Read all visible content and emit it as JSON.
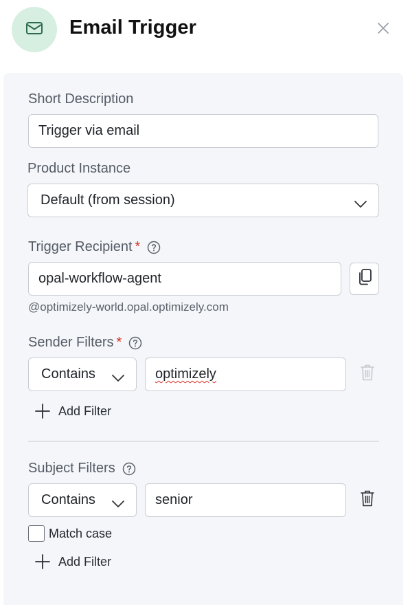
{
  "header": {
    "title": "Email Trigger",
    "icon": "envelope-icon",
    "avatar_color": "#d6efe1",
    "close_icon": "close-icon"
  },
  "short_description": {
    "label": "Short Description",
    "value": "Trigger via email"
  },
  "product_instance": {
    "label": "Product Instance",
    "selected": "Default (from session)"
  },
  "trigger_recipient": {
    "label": "Trigger Recipient",
    "required_mark": "*",
    "value": "opal-workflow-agent",
    "domain_suffix": "@optimizely-world.opal.optimizely.com"
  },
  "sender_filters": {
    "label": "Sender Filters",
    "required_mark": "*",
    "filters": [
      {
        "operator": "Contains",
        "value": "optimizely",
        "delete_enabled": false
      }
    ],
    "add_label": "Add Filter"
  },
  "subject_filters": {
    "label": "Subject Filters",
    "filters": [
      {
        "operator": "Contains",
        "value": "senior",
        "delete_enabled": true
      }
    ],
    "match_case_label": "Match case",
    "match_case_checked": false,
    "add_label": "Add Filter"
  },
  "colors": {
    "required": "#d93025",
    "panel_bg": "#f4f6f9",
    "border": "#c9cdd3"
  }
}
